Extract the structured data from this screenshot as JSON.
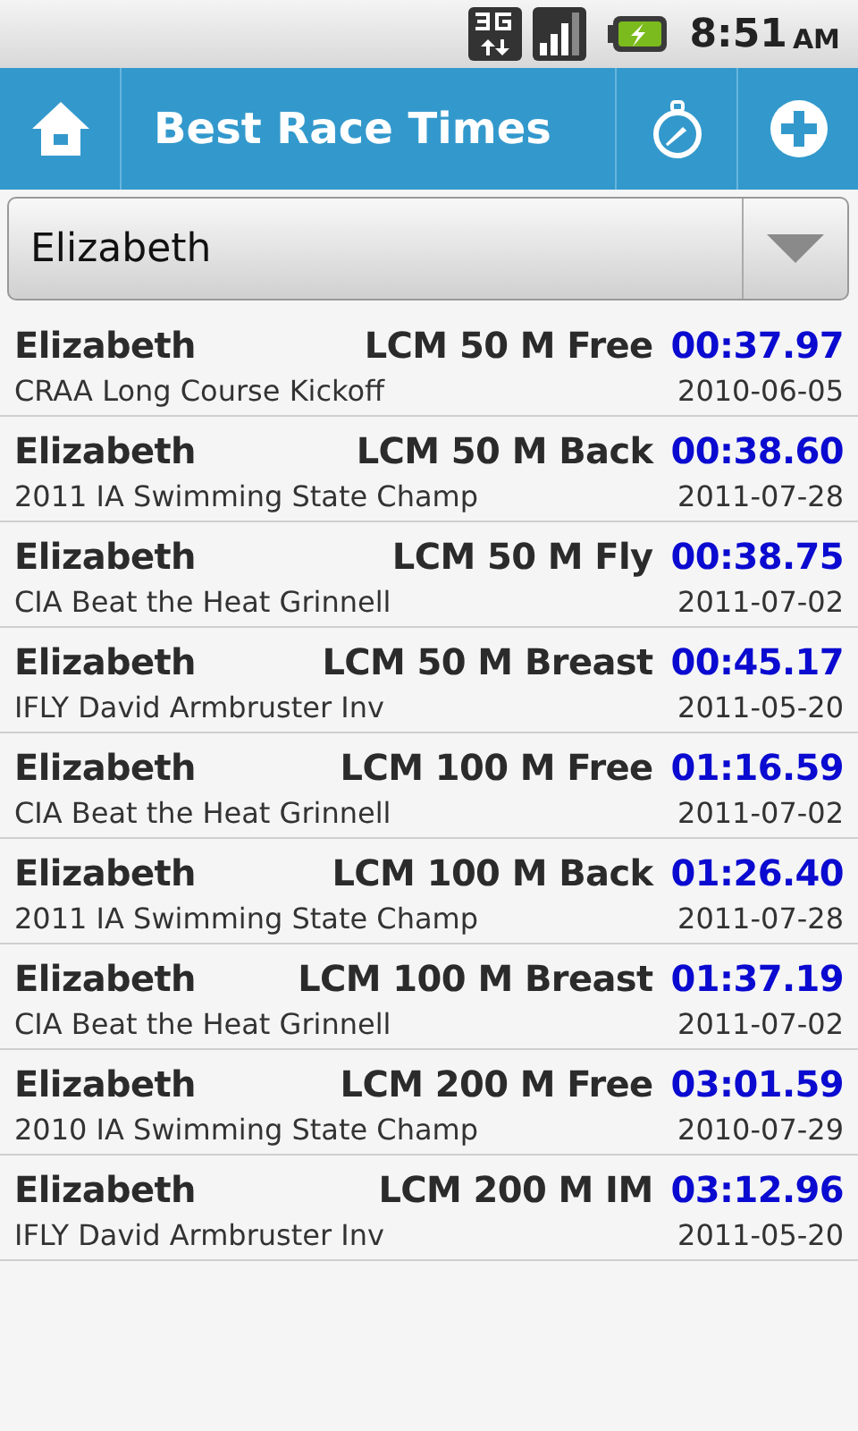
{
  "status_bar": {
    "time": "8:51",
    "ampm": "AM"
  },
  "action_bar": {
    "title": "Best Race Times"
  },
  "swimmer_spinner": {
    "value": "Elizabeth"
  },
  "results": [
    {
      "swimmer": "Elizabeth",
      "event": "LCM 50 M Free",
      "time": "00:37.97",
      "meet": "CRAA Long Course Kickoff",
      "date": "2010-06-05"
    },
    {
      "swimmer": "Elizabeth",
      "event": "LCM 50 M Back",
      "time": "00:38.60",
      "meet": "2011 IA Swimming State Champ",
      "date": "2011-07-28"
    },
    {
      "swimmer": "Elizabeth",
      "event": "LCM 50 M Fly",
      "time": "00:38.75",
      "meet": "CIA Beat the Heat Grinnell",
      "date": "2011-07-02"
    },
    {
      "swimmer": "Elizabeth",
      "event": "LCM 50 M Breast",
      "time": "00:45.17",
      "meet": "IFLY David Armbruster Inv",
      "date": "2011-05-20"
    },
    {
      "swimmer": "Elizabeth",
      "event": "LCM 100 M Free",
      "time": "01:16.59",
      "meet": "CIA Beat the Heat Grinnell",
      "date": "2011-07-02"
    },
    {
      "swimmer": "Elizabeth",
      "event": "LCM 100 M Back",
      "time": "01:26.40",
      "meet": "2011 IA Swimming State Champ",
      "date": "2011-07-28"
    },
    {
      "swimmer": "Elizabeth",
      "event": "LCM 100 M Breast",
      "time": "01:37.19",
      "meet": "CIA Beat the Heat Grinnell",
      "date": "2011-07-02"
    },
    {
      "swimmer": "Elizabeth",
      "event": "LCM 200 M Free",
      "time": "03:01.59",
      "meet": "2010 IA Swimming State Champ",
      "date": "2010-07-29"
    },
    {
      "swimmer": "Elizabeth",
      "event": "LCM 200 M IM",
      "time": "03:12.96",
      "meet": "IFLY David Armbruster Inv",
      "date": "2011-05-20"
    }
  ]
}
